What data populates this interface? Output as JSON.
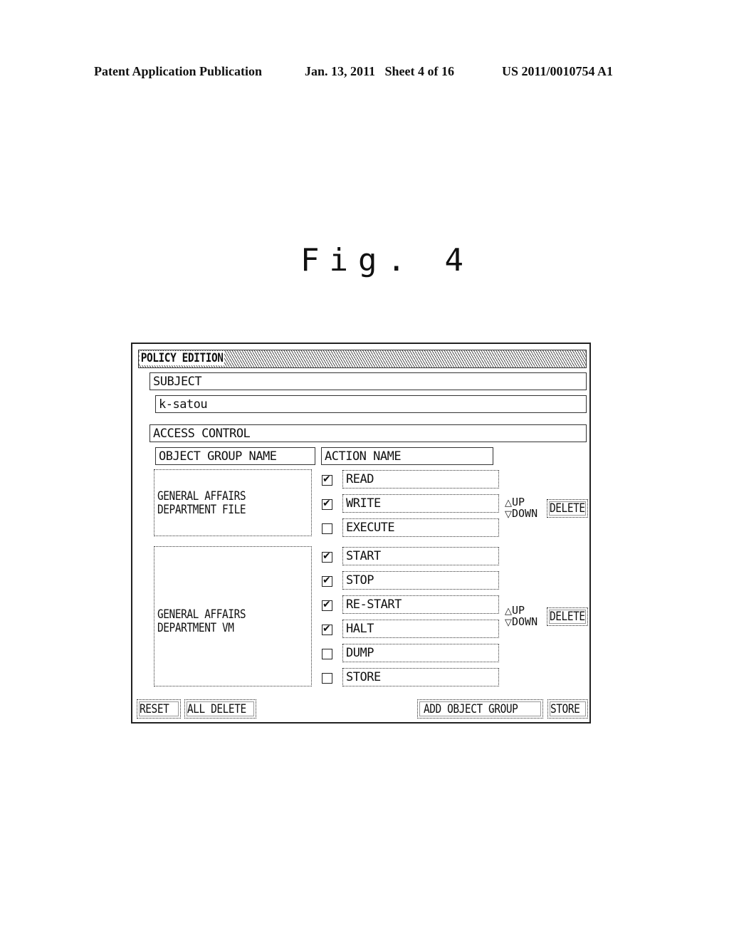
{
  "header": {
    "publication": "Patent Application Publication",
    "date_sheet": "Jan. 13, 2011   Sheet 4 of 16",
    "patent_number": "US 2011/0010754 A1"
  },
  "figure_label": "Fig. 4",
  "window": {
    "title": "POLICY EDITION",
    "subject_label": "SUBJECT",
    "subject_value": "k-satou",
    "access_control_label": "ACCESS CONTROL",
    "columns": {
      "object_group": "OBJECT GROUP NAME",
      "action": "ACTION NAME"
    },
    "groups": [
      {
        "name_line1": "GENERAL AFFAIRS",
        "name_line2": "DEPARTMENT FILE",
        "actions": [
          {
            "label": "READ",
            "checked": true
          },
          {
            "label": "WRITE",
            "checked": true
          },
          {
            "label": "EXECUTE",
            "checked": false
          }
        ],
        "up_label": "UP",
        "down_label": "DOWN",
        "delete_label": "DELETE"
      },
      {
        "name_line1": "GENERAL AFFAIRS",
        "name_line2": "DEPARTMENT VM",
        "actions": [
          {
            "label": "START",
            "checked": true
          },
          {
            "label": "STOP",
            "checked": true
          },
          {
            "label": "RE-START",
            "checked": true
          },
          {
            "label": "HALT",
            "checked": true
          },
          {
            "label": "DUMP",
            "checked": false
          },
          {
            "label": "STORE",
            "checked": false
          }
        ],
        "up_label": "UP",
        "down_label": "DOWN",
        "delete_label": "DELETE"
      }
    ],
    "buttons": {
      "reset": "RESET",
      "all_delete": "ALL DELETE",
      "add_object_group": "ADD OBJECT GROUP",
      "store": "STORE"
    },
    "icons": {
      "up": "up-triangle-icon",
      "down": "down-triangle-icon",
      "check": "checkmark-icon"
    }
  }
}
